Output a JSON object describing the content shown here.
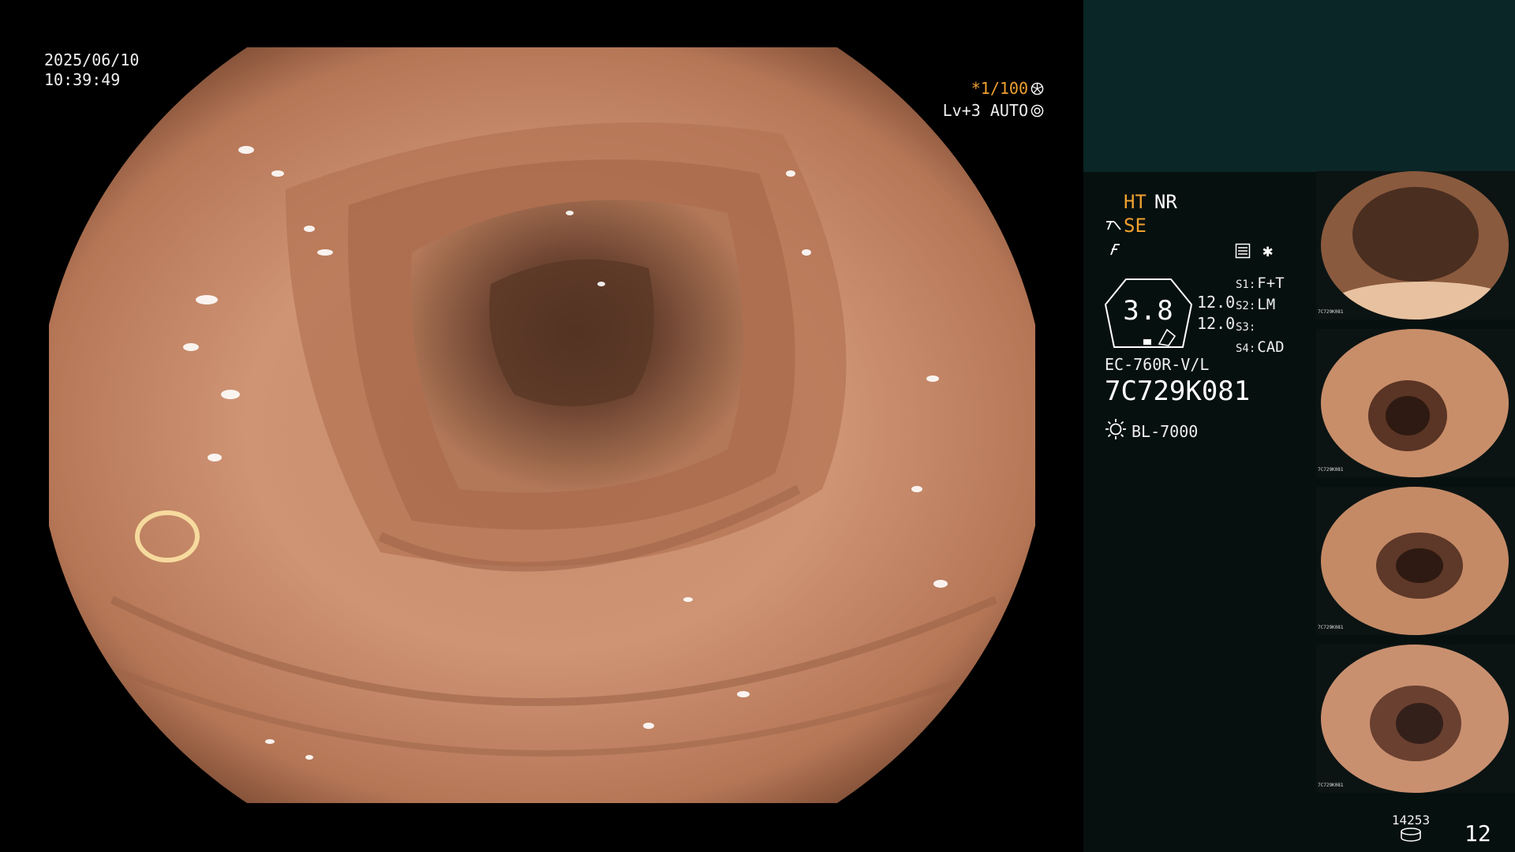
{
  "datetime": {
    "date": "2025/06/10",
    "time": "10:39:49"
  },
  "overlay": {
    "shutter": "*1/100",
    "shutter_icon": "aperture-icon",
    "level": "Lv+3 AUTO",
    "auto_icon": "auto-iris-icon"
  },
  "panel": {
    "ht": "HT",
    "nr": "NR",
    "se": "SE",
    "dial_value": "3.8",
    "dial_nums": [
      "12.0",
      "12.0"
    ],
    "settings": [
      {
        "key": "S1:",
        "value": "F+T"
      },
      {
        "key": "S2:",
        "value": "LM"
      },
      {
        "key": "S3:",
        "value": ""
      },
      {
        "key": "S4:",
        "value": "CAD"
      }
    ],
    "model": "EC-760R-V/L",
    "serial": "7C729K081",
    "light_source": "BL-7000"
  },
  "thumbnails": [
    {
      "label": "7C729K081"
    },
    {
      "label": "7C729K081"
    },
    {
      "label": "7C729K081"
    },
    {
      "label": "7C729K081"
    }
  ],
  "counter": {
    "count": "14253",
    "page": "12"
  },
  "colors": {
    "accent_orange": "#f0a030",
    "panel_bg": "#06100f",
    "panel_top_bg": "#0a2626"
  }
}
